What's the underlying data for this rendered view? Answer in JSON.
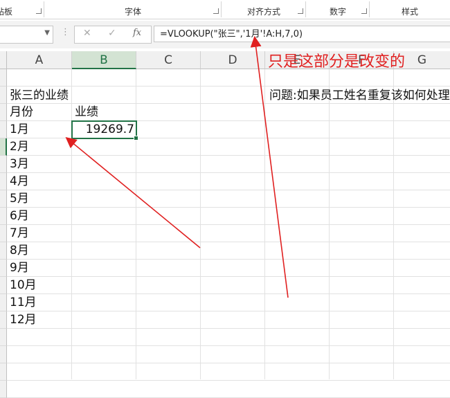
{
  "ribbon": {
    "groups": [
      {
        "label": "贴板"
      },
      {
        "label": "字体"
      },
      {
        "label": "对齐方式"
      },
      {
        "label": "数字"
      },
      {
        "label": "样式"
      }
    ]
  },
  "formula_bar": {
    "name_box": "",
    "cancel_icon": "✕",
    "enter_icon": "✓",
    "fx_label": "fx",
    "formula": "=VLOOKUP(\"张三\",'1月'!A:H,7,0)"
  },
  "columns": [
    "A",
    "B",
    "C",
    "D",
    "E",
    "F",
    "G"
  ],
  "selected_column": "B",
  "cells": {
    "title": "张三的业绩",
    "header_month": "月份",
    "header_perf": "业绩",
    "months": [
      "1月",
      "2月",
      "3月",
      "4月",
      "5月",
      "6月",
      "7月",
      "8月",
      "9月",
      "10月",
      "11月",
      "12月"
    ],
    "b_value": "19269.7",
    "question": "问题:如果员工姓名重复该如何处理"
  },
  "row_header_fragments": [
    "",
    "",
    "",
    "",
    "",
    "",
    "",
    "",
    "",
    "",
    "",
    "",
    "",
    "",
    "",
    "",
    "",
    "",
    ""
  ],
  "annotation": {
    "text": "只是这部分是改变的",
    "color": "#e02020"
  },
  "colors": {
    "accent": "#217346",
    "arrow": "#e02020"
  }
}
